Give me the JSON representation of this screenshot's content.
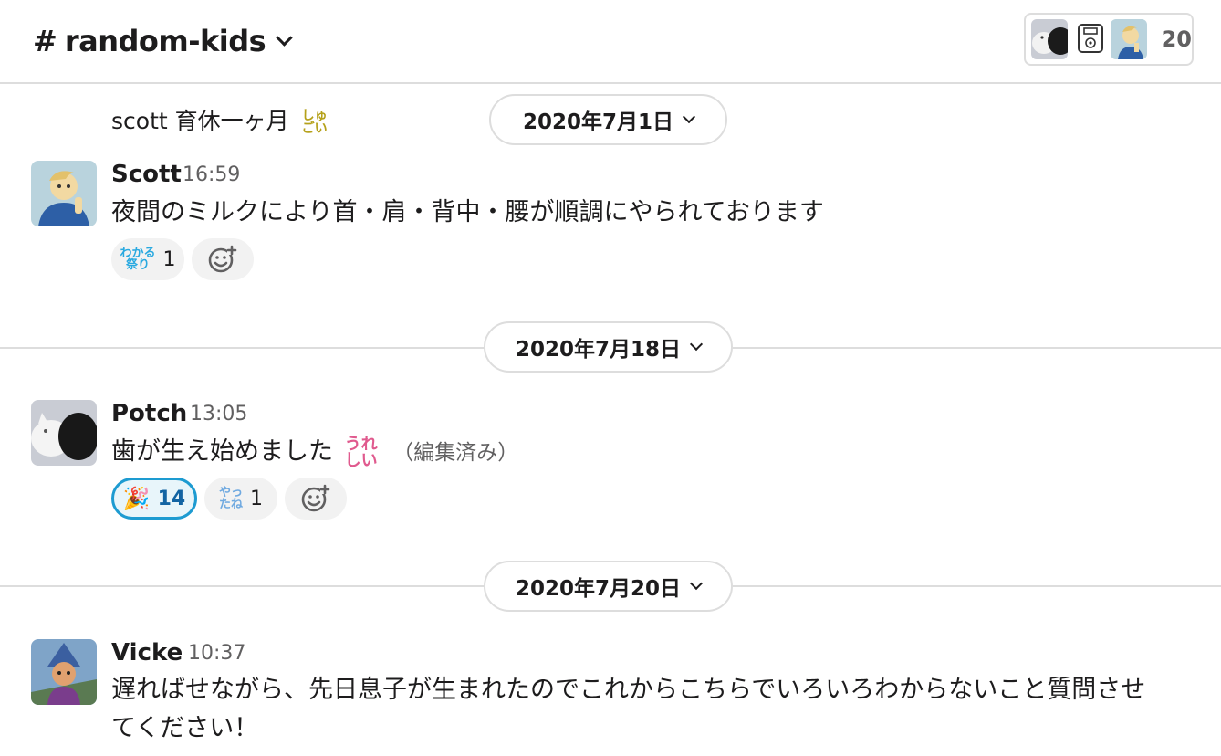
{
  "header": {
    "channel_hash": "#",
    "channel_name": "random-kids",
    "member_count": "20"
  },
  "messages_top": {
    "topic_text": "scott 育休一ヶ月",
    "topic_emoji_line1": "しゅ",
    "topic_emoji_line2": "ごい"
  },
  "dates": [
    {
      "label": "2020年7月1日"
    },
    {
      "label": "2020年7月18日"
    },
    {
      "label": "2020年7月20日"
    }
  ],
  "messages": [
    {
      "author": "Scott",
      "time": "16:59",
      "text": "夜間のミルクにより首・肩・背中・腰が順調にやられております",
      "reactions": [
        {
          "emoji_line1": "わかる",
          "emoji_line2": "祭り",
          "count": "1",
          "color": "#29a9e0"
        }
      ]
    },
    {
      "author": "Potch",
      "time": "13:05",
      "text": "歯が生え始めました",
      "inline_emoji_line1": "うれ",
      "inline_emoji_line2": "しい",
      "edited": "（編集済み）",
      "reactions": [
        {
          "emoji": "🎉",
          "count": "14",
          "active": true
        },
        {
          "emoji_line1": "やっ",
          "emoji_line2": "たね",
          "count": "1",
          "color": "#6fa9e0"
        }
      ]
    },
    {
      "author": "Vicke",
      "time": "10:37",
      "text_line1": "遅ればせながら、先日息子が生まれたのでこれからこちらでいろいろわからないこと質問させ",
      "text_line2": "てください！"
    }
  ],
  "icons": {
    "add_reaction": "add-reaction-icon",
    "chevron": "chevron-down-icon"
  },
  "colors": {
    "accent": "#1d9bd1",
    "topic_emoji": "#b5a11a",
    "inline_emoji": "#e05a8e"
  }
}
